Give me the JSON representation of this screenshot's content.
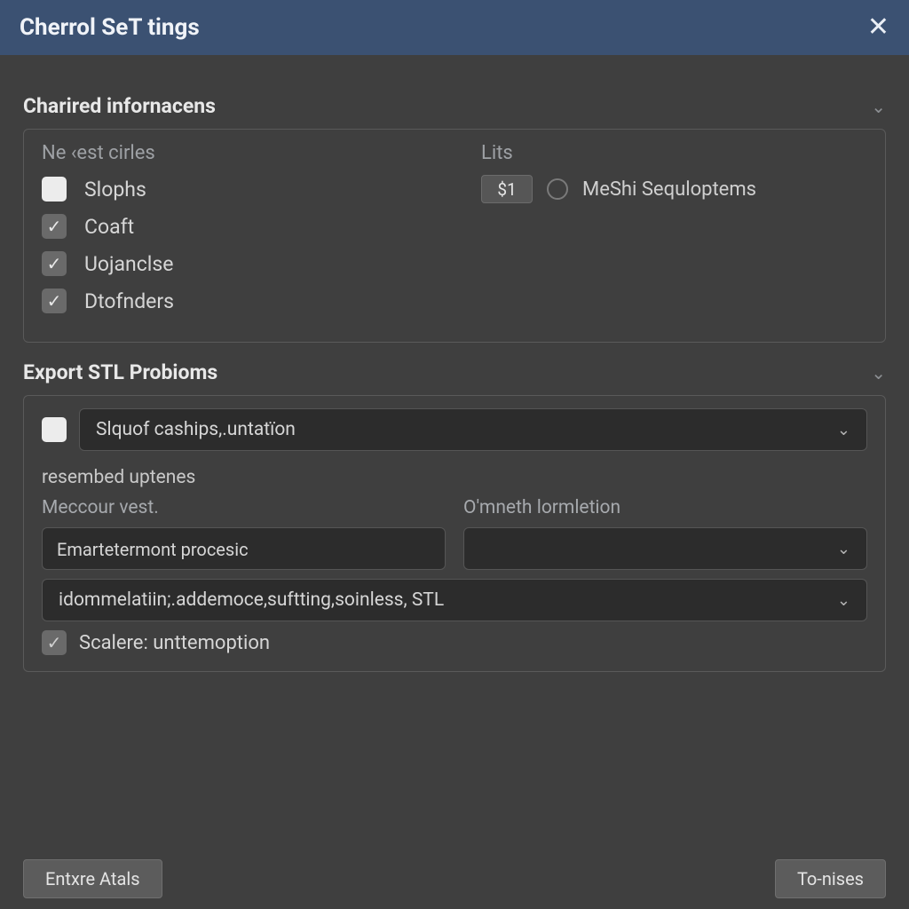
{
  "titlebar": {
    "title": "Cherrol SeT tings"
  },
  "section1": {
    "title": "Charired infornacens",
    "leftLabel": "Ne ‹est cirles",
    "checks": [
      {
        "label": "Slophs",
        "checked": false
      },
      {
        "label": "Coaft",
        "checked": true
      },
      {
        "label": "Uojanclse",
        "checked": true
      },
      {
        "label": "Dtofnders",
        "checked": true
      }
    ],
    "rightLabel": "Lits",
    "rightValue": "$1",
    "radioLabel": "MeShi Sequloptems"
  },
  "section2": {
    "title": "Export STL Probioms",
    "topDropdown": "Slquof caships,.untatïon",
    "subTitle": "resembed uptenes",
    "leftFieldLabel": "Meccour vest.",
    "leftFieldValue": "Emartetermont procesic",
    "rightFieldLabel": "O'mneth lormletion",
    "rightFieldValue": "",
    "longDropdown": "idommelatiin;.addemoce,suftting,soinless, STL",
    "scaleLabel": "Scalere: unttemoption"
  },
  "footer": {
    "left": "Entxre Atals",
    "right": "To-nises"
  }
}
